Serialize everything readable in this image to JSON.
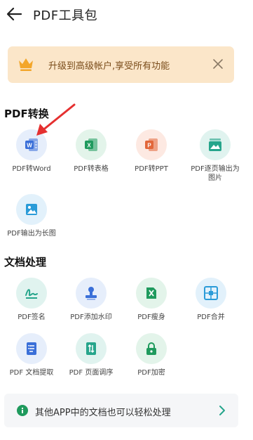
{
  "header": {
    "title": "PDF工具包",
    "back_icon": "arrow-left-icon"
  },
  "banner": {
    "text": "升级到高级帐户,享受所有功能",
    "icon": "crown-icon",
    "close_icon": "close-icon"
  },
  "sections": [
    {
      "title": "PDF转换"
    },
    {
      "title": "文档处理"
    }
  ],
  "convert_tools": [
    {
      "label": "PDF转Word",
      "icon": "word-icon"
    },
    {
      "label": "PDF转表格",
      "icon": "excel-icon"
    },
    {
      "label": "PDF转PPT",
      "icon": "ppt-icon"
    },
    {
      "label": "PDF逐页输出为",
      "label2": "图片",
      "icon": "image-gallery-icon"
    },
    {
      "label": "PDF输出为长图",
      "icon": "image-icon"
    }
  ],
  "process_tools": [
    {
      "label": "PDF签名",
      "icon": "signature-icon"
    },
    {
      "label": "PDF添加水印",
      "icon": "stamp-icon"
    },
    {
      "label": "PDF瘦身",
      "icon": "compress-icon"
    },
    {
      "label": "PDF合并",
      "icon": "merge-icon"
    },
    {
      "label": "PDF 文档提取",
      "icon": "extract-icon"
    },
    {
      "label": "PDF 页面调序",
      "icon": "reorder-icon"
    },
    {
      "label": "PDF加密",
      "icon": "lock-icon"
    }
  ],
  "footer": {
    "text": "其他APP中的文档也可以轻松处理",
    "icon": "info-icon",
    "chevron_icon": "chevron-right-icon"
  },
  "colors": {
    "accent_blue": "#3a6fd8",
    "accent_green": "#1f9a5d",
    "accent_orange": "#e2673a",
    "accent_teal": "#26a58b",
    "banner_bg": "#fbe6c9",
    "banner_text": "#7a4c1a",
    "crown": "#f3a62a"
  }
}
